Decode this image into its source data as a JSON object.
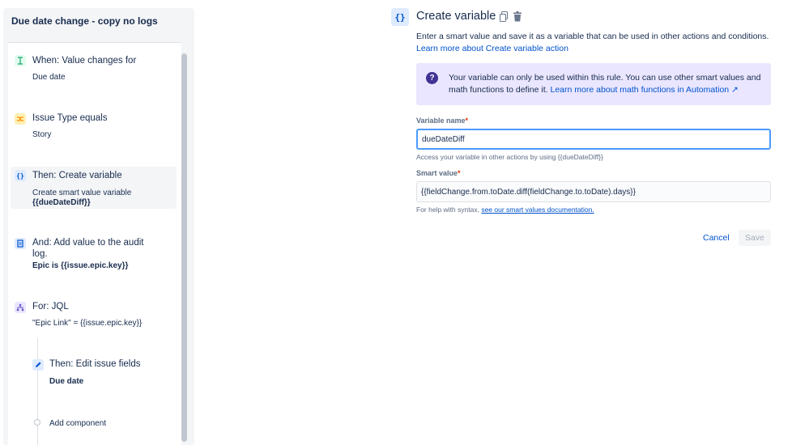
{
  "rule": {
    "title": "Due date change - copy no logs",
    "steps": [
      {
        "title": "When: Value changes for",
        "sub": "Due date",
        "icon": "trigger-icon",
        "color": "#36b37e"
      },
      {
        "title": "Issue Type equals",
        "sub": "Story",
        "icon": "condition-icon",
        "color": "#ffab00"
      },
      {
        "title": "Then: Create variable",
        "sub": "Create smart value variable",
        "bold": "{{dueDateDiff}}",
        "icon": "braces-icon",
        "color": "#0052cc"
      },
      {
        "title_line1": "And: Add value to the audit",
        "title_line2": "log.",
        "bold": "Epic is {{issue.epic.key}}",
        "icon": "audit-log-icon",
        "color": "#0052cc"
      },
      {
        "title": "For: JQL",
        "sub": "\"Epic Link\" = {{issue.epic.key}}",
        "icon": "branch-icon",
        "color": "#6554c0"
      },
      {
        "title": "Then: Edit issue fields",
        "bold": "Due date",
        "icon": "pencil-icon",
        "color": "#0052cc"
      }
    ],
    "add_component": "Add component"
  },
  "panel": {
    "icon_glyph": "{}",
    "title": "Create variable",
    "description": "Enter a smart value and save it as a variable that can be used in other actions and conditions.",
    "learn_more": "Learn more about Create variable action",
    "info_line1": "Your variable can only be used within this rule. You can use other smart values and",
    "info_line2": "math functions to define it.",
    "info_link": "Learn more about math functions in Automation ↗",
    "variable_name_label": "Variable name",
    "variable_name_value": "dueDateDiff",
    "variable_name_help": "Access your variable in other actions by using {{dueDateDiff}}",
    "smart_value_label": "Smart value",
    "smart_value_value": "{{fieldChange.from.toDate.diff(fieldChange.to.toDate).days}}",
    "smart_value_help_prefix": "For help with syntax,",
    "smart_value_help_link": "see our smart values documentation.",
    "required_mark": "*",
    "cancel_label": "Cancel",
    "save_label": "Save"
  }
}
